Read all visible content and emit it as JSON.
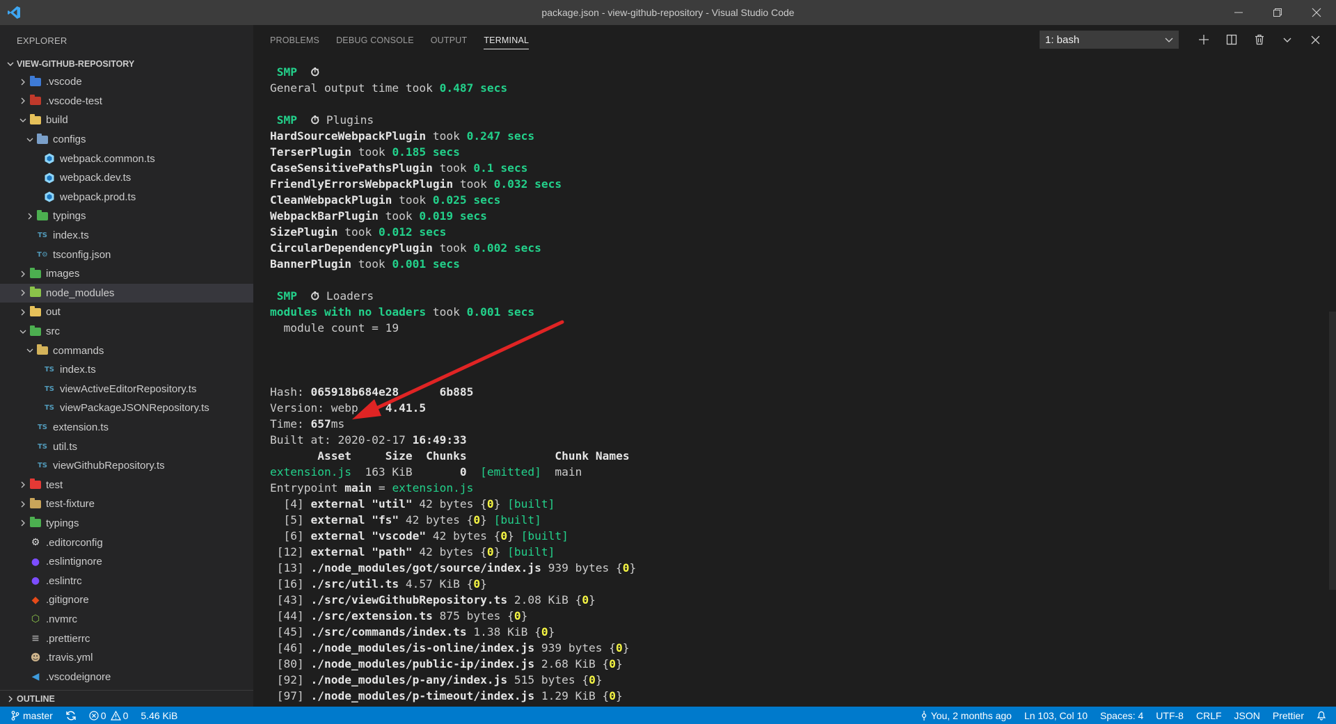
{
  "window": {
    "title": "package.json - view-github-repository - Visual Studio Code",
    "controls": [
      "minimize",
      "restore",
      "close"
    ]
  },
  "sidebar": {
    "title": "EXPLORER",
    "project": "VIEW-GITHUB-REPOSITORY",
    "outline_label": "OUTLINE",
    "items": [
      {
        "label": ".vscode",
        "depth": 0,
        "kind": "folder",
        "expanded": false,
        "icon": "vscode-folder-icon",
        "color": "#3e7bd6"
      },
      {
        "label": ".vscode-test",
        "depth": 0,
        "kind": "folder",
        "expanded": false,
        "icon": "vscode-test-folder-icon",
        "color": "#c0392b"
      },
      {
        "label": "build",
        "depth": 0,
        "kind": "folder",
        "expanded": true,
        "icon": "build-folder-icon",
        "color": "#e6c15a"
      },
      {
        "label": "configs",
        "depth": 1,
        "kind": "folder",
        "expanded": true,
        "icon": "config-folder-icon",
        "color": "#7a9fc9"
      },
      {
        "label": "webpack.common.ts",
        "depth": 2,
        "kind": "file",
        "icon": "webpack-icon",
        "color": "#8ed6fb"
      },
      {
        "label": "webpack.dev.ts",
        "depth": 2,
        "kind": "file",
        "icon": "webpack-icon",
        "color": "#8ed6fb"
      },
      {
        "label": "webpack.prod.ts",
        "depth": 2,
        "kind": "file",
        "icon": "webpack-icon",
        "color": "#8ed6fb"
      },
      {
        "label": "typings",
        "depth": 1,
        "kind": "folder",
        "expanded": false,
        "icon": "typings-folder-icon",
        "color": "#4caf50"
      },
      {
        "label": "index.ts",
        "depth": 1,
        "kind": "file",
        "icon": "ts-icon",
        "glyph": "TS",
        "color": "#519aba"
      },
      {
        "label": "tsconfig.json",
        "depth": 1,
        "kind": "file",
        "icon": "tsconfig-icon",
        "glyph": "T⚙",
        "color": "#519aba"
      },
      {
        "label": "images",
        "depth": 0,
        "kind": "folder",
        "expanded": false,
        "icon": "images-folder-icon",
        "color": "#4caf50"
      },
      {
        "label": "node_modules",
        "depth": 0,
        "kind": "folder",
        "expanded": false,
        "icon": "node-modules-folder-icon",
        "color": "#8bc34a",
        "selected": true
      },
      {
        "label": "out",
        "depth": 0,
        "kind": "folder",
        "expanded": false,
        "icon": "out-folder-icon",
        "color": "#e6c15a"
      },
      {
        "label": "src",
        "depth": 0,
        "kind": "folder",
        "expanded": true,
        "icon": "src-folder-icon",
        "color": "#4caf50"
      },
      {
        "label": "commands",
        "depth": 1,
        "kind": "folder",
        "expanded": true,
        "icon": "commands-folder-icon",
        "color": "#d4b35a"
      },
      {
        "label": "index.ts",
        "depth": 2,
        "kind": "file",
        "icon": "ts-icon",
        "glyph": "TS",
        "color": "#519aba"
      },
      {
        "label": "viewActiveEditorRepository.ts",
        "depth": 2,
        "kind": "file",
        "icon": "ts-icon",
        "glyph": "TS",
        "color": "#519aba"
      },
      {
        "label": "viewPackageJSONRepository.ts",
        "depth": 2,
        "kind": "file",
        "icon": "ts-icon",
        "glyph": "TS",
        "color": "#519aba"
      },
      {
        "label": "extension.ts",
        "depth": 1,
        "kind": "file",
        "icon": "ts-icon",
        "glyph": "TS",
        "color": "#519aba"
      },
      {
        "label": "util.ts",
        "depth": 1,
        "kind": "file",
        "icon": "ts-icon",
        "glyph": "TS",
        "color": "#519aba"
      },
      {
        "label": "viewGithubRepository.ts",
        "depth": 1,
        "kind": "file",
        "icon": "ts-icon",
        "glyph": "TS",
        "color": "#519aba"
      },
      {
        "label": "test",
        "depth": 0,
        "kind": "folder",
        "expanded": false,
        "icon": "test-folder-icon",
        "color": "#e53935"
      },
      {
        "label": "test-fixture",
        "depth": 0,
        "kind": "folder",
        "expanded": false,
        "icon": "folder-icon",
        "color": "#c9a55a"
      },
      {
        "label": "typings",
        "depth": 0,
        "kind": "folder",
        "expanded": false,
        "icon": "typings-folder-icon",
        "color": "#4caf50"
      },
      {
        "label": ".editorconfig",
        "depth": 0,
        "kind": "file",
        "icon": "editorconfig-icon",
        "glyph": "⚙",
        "color": "#dddddd"
      },
      {
        "label": ".eslintignore",
        "depth": 0,
        "kind": "file",
        "icon": "eslint-icon",
        "glyph": "●",
        "color": "#7c4dff"
      },
      {
        "label": ".eslintrc",
        "depth": 0,
        "kind": "file",
        "icon": "eslint-icon",
        "glyph": "●",
        "color": "#7c4dff"
      },
      {
        "label": ".gitignore",
        "depth": 0,
        "kind": "file",
        "icon": "git-icon",
        "glyph": "◆",
        "color": "#e64a19"
      },
      {
        "label": ".nvmrc",
        "depth": 0,
        "kind": "file",
        "icon": "node-icon",
        "glyph": "⬡",
        "color": "#8bc34a"
      },
      {
        "label": ".prettierrc",
        "depth": 0,
        "kind": "file",
        "icon": "prettier-icon",
        "glyph": "≡",
        "color": "#a0a0a0"
      },
      {
        "label": ".travis.yml",
        "depth": 0,
        "kind": "file",
        "icon": "travis-icon",
        "glyph": "☻",
        "color": "#cdb38b"
      },
      {
        "label": ".vscodeignore",
        "depth": 0,
        "kind": "file",
        "icon": "vscode-icon",
        "glyph": "◀",
        "color": "#3e9bdc"
      }
    ]
  },
  "panel": {
    "tabs": [
      "PROBLEMS",
      "DEBUG CONSOLE",
      "OUTPUT",
      "TERMINAL"
    ],
    "active_tab": "TERMINAL",
    "terminal_select": "1: bash"
  },
  "terminal": {
    "lines": [
      [
        {
          "t": " SMP  ",
          "c": "g"
        },
        {
          "t": "⏱",
          "c": "w"
        }
      ],
      [
        {
          "t": "General output time took "
        },
        {
          "t": "0.487 secs",
          "c": "g"
        }
      ],
      [],
      [
        {
          "t": " SMP  ",
          "c": "g"
        },
        {
          "t": "⏱",
          "c": "w"
        },
        {
          "t": " Plugins"
        }
      ],
      [
        {
          "t": "HardSourceWebpackPlugin",
          "c": "b"
        },
        {
          "t": " took "
        },
        {
          "t": "0.247 secs",
          "c": "g"
        }
      ],
      [
        {
          "t": "TerserPlugin",
          "c": "b"
        },
        {
          "t": " took "
        },
        {
          "t": "0.185 secs",
          "c": "g"
        }
      ],
      [
        {
          "t": "CaseSensitivePathsPlugin",
          "c": "b"
        },
        {
          "t": " took "
        },
        {
          "t": "0.1 secs",
          "c": "g"
        }
      ],
      [
        {
          "t": "FriendlyErrorsWebpackPlugin",
          "c": "b"
        },
        {
          "t": " took "
        },
        {
          "t": "0.032 secs",
          "c": "g"
        }
      ],
      [
        {
          "t": "CleanWebpackPlugin",
          "c": "b"
        },
        {
          "t": " took "
        },
        {
          "t": "0.025 secs",
          "c": "g"
        }
      ],
      [
        {
          "t": "WebpackBarPlugin",
          "c": "b"
        },
        {
          "t": " took "
        },
        {
          "t": "0.019 secs",
          "c": "g"
        }
      ],
      [
        {
          "t": "SizePlugin",
          "c": "b"
        },
        {
          "t": " took "
        },
        {
          "t": "0.012 secs",
          "c": "g"
        }
      ],
      [
        {
          "t": "CircularDependencyPlugin",
          "c": "b"
        },
        {
          "t": " took "
        },
        {
          "t": "0.002 secs",
          "c": "g"
        }
      ],
      [
        {
          "t": "BannerPlugin",
          "c": "b"
        },
        {
          "t": " took "
        },
        {
          "t": "0.001 secs",
          "c": "g"
        }
      ],
      [],
      [
        {
          "t": " SMP  ",
          "c": "g"
        },
        {
          "t": "⏱",
          "c": "w"
        },
        {
          "t": " Loaders"
        }
      ],
      [
        {
          "t": "modules with no loaders",
          "c": "g"
        },
        {
          "t": " took "
        },
        {
          "t": "0.001 secs",
          "c": "g"
        }
      ],
      [
        {
          "t": "  module count = 19"
        }
      ],
      [],
      [],
      [],
      [
        {
          "t": "Hash: "
        },
        {
          "t": "065918b684e28",
          "c": "b"
        },
        {
          "t": "      "
        },
        {
          "t": "6b885",
          "c": "b"
        }
      ],
      [
        {
          "t": "Version: webp    "
        },
        {
          "t": "4.41.5",
          "c": "b"
        }
      ],
      [
        {
          "t": "Time: "
        },
        {
          "t": "657",
          "c": "b"
        },
        {
          "t": "ms"
        }
      ],
      [
        {
          "t": "Built at: 2020-02-17 "
        },
        {
          "t": "16:49:33",
          "c": "b"
        }
      ],
      [
        {
          "t": "       Asset",
          "c": "b"
        },
        {
          "t": "     "
        },
        {
          "t": "Size",
          "c": "b"
        },
        {
          "t": "  "
        },
        {
          "t": "Chunks",
          "c": "b"
        },
        {
          "t": "             "
        },
        {
          "t": "Chunk Names",
          "c": "b"
        }
      ],
      [
        {
          "t": "extension.js",
          "c": "gn"
        },
        {
          "t": "  163 KiB       "
        },
        {
          "t": "0",
          "c": "b"
        },
        {
          "t": "  "
        },
        {
          "t": "[emitted]",
          "c": "gn"
        },
        {
          "t": "  main"
        }
      ],
      [
        {
          "t": "Entrypoint "
        },
        {
          "t": "main",
          "c": "b"
        },
        {
          "t": " = "
        },
        {
          "t": "extension.js",
          "c": "gn"
        }
      ],
      [
        {
          "t": "  [4] "
        },
        {
          "t": "external \"util\"",
          "c": "b"
        },
        {
          "t": " 42 bytes {"
        },
        {
          "t": "0",
          "c": "y"
        },
        {
          "t": "} "
        },
        {
          "t": "[built]",
          "c": "gn"
        }
      ],
      [
        {
          "t": "  [5] "
        },
        {
          "t": "external \"fs\"",
          "c": "b"
        },
        {
          "t": " 42 bytes {"
        },
        {
          "t": "0",
          "c": "y"
        },
        {
          "t": "} "
        },
        {
          "t": "[built]",
          "c": "gn"
        }
      ],
      [
        {
          "t": "  [6] "
        },
        {
          "t": "external \"vscode\"",
          "c": "b"
        },
        {
          "t": " 42 bytes {"
        },
        {
          "t": "0",
          "c": "y"
        },
        {
          "t": "} "
        },
        {
          "t": "[built]",
          "c": "gn"
        }
      ],
      [
        {
          "t": " [12] "
        },
        {
          "t": "external \"path\"",
          "c": "b"
        },
        {
          "t": " 42 bytes {"
        },
        {
          "t": "0",
          "c": "y"
        },
        {
          "t": "} "
        },
        {
          "t": "[built]",
          "c": "gn"
        }
      ],
      [
        {
          "t": " [13] "
        },
        {
          "t": "./node_modules/got/source/index.js",
          "c": "b"
        },
        {
          "t": " 939 bytes {"
        },
        {
          "t": "0",
          "c": "y"
        },
        {
          "t": "}"
        }
      ],
      [
        {
          "t": " [16] "
        },
        {
          "t": "./src/util.ts",
          "c": "b"
        },
        {
          "t": " 4.57 KiB {"
        },
        {
          "t": "0",
          "c": "y"
        },
        {
          "t": "}"
        }
      ],
      [
        {
          "t": " [43] "
        },
        {
          "t": "./src/viewGithubRepository.ts",
          "c": "b"
        },
        {
          "t": " 2.08 KiB {"
        },
        {
          "t": "0",
          "c": "y"
        },
        {
          "t": "}"
        }
      ],
      [
        {
          "t": " [44] "
        },
        {
          "t": "./src/extension.ts",
          "c": "b"
        },
        {
          "t": " 875 bytes {"
        },
        {
          "t": "0",
          "c": "y"
        },
        {
          "t": "}"
        }
      ],
      [
        {
          "t": " [45] "
        },
        {
          "t": "./src/commands/index.ts",
          "c": "b"
        },
        {
          "t": " 1.38 KiB {"
        },
        {
          "t": "0",
          "c": "y"
        },
        {
          "t": "}"
        }
      ],
      [
        {
          "t": " [46] "
        },
        {
          "t": "./node_modules/is-online/index.js",
          "c": "b"
        },
        {
          "t": " 939 bytes {"
        },
        {
          "t": "0",
          "c": "y"
        },
        {
          "t": "}"
        }
      ],
      [
        {
          "t": " [80] "
        },
        {
          "t": "./node_modules/public-ip/index.js",
          "c": "b"
        },
        {
          "t": " 2.68 KiB {"
        },
        {
          "t": "0",
          "c": "y"
        },
        {
          "t": "}"
        }
      ],
      [
        {
          "t": " [92] "
        },
        {
          "t": "./node_modules/p-any/index.js",
          "c": "b"
        },
        {
          "t": " 515 bytes {"
        },
        {
          "t": "0",
          "c": "y"
        },
        {
          "t": "}"
        }
      ],
      [
        {
          "t": " [97] "
        },
        {
          "t": "./node_modules/p-timeout/index.js",
          "c": "b"
        },
        {
          "t": " 1.29 KiB {"
        },
        {
          "t": "0",
          "c": "y"
        },
        {
          "t": "}"
        }
      ]
    ]
  },
  "statusbar": {
    "branch": "master",
    "errors": "0",
    "warnings": "0",
    "size": "5.46 KiB",
    "blame": "You, 2 months ago",
    "position": "Ln 103, Col 10",
    "spaces": "Spaces: 4",
    "encoding": "UTF-8",
    "eol": "CRLF",
    "language": "JSON",
    "formatter": "Prettier"
  },
  "colors": {
    "accent": "#007acc",
    "annotation_arrow": "#e02424"
  }
}
